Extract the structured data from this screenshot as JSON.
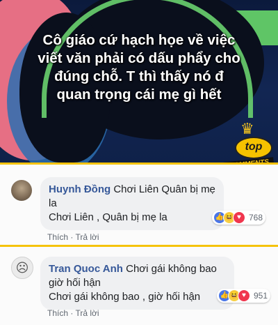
{
  "banner": {
    "caption_lines": [
      "Cô giáo cứ hạch họe về việc",
      "viết văn phải có dấu phẩy cho",
      "đúng chỗ. T thì thấy nó đ",
      "quan trọng cái mẹ gì hết"
    ],
    "badge_top": "top",
    "badge_comments": "COMMENTS",
    "badge_icon": "crown-icon"
  },
  "comments": [
    {
      "author": "Huynh Đồng",
      "text_part1": " Chơi Liên Quân bị mẹ la",
      "text_line2": "Chơi Liên , Quân bị mẹ la",
      "reaction_count": "768",
      "actions": {
        "like": "Thích",
        "separator": " · ",
        "reply": "Trả lời"
      },
      "avatar_icon": "user-avatar"
    },
    {
      "author": "Tran Quoc Anh",
      "text_part1": " Chơi gái không bao giờ hối hận",
      "text_line2": "Chơi gái không bao , giờ hối hận",
      "reaction_count": "951",
      "actions": {
        "like": "Thích",
        "separator": " · ",
        "reply": "Trả lời"
      },
      "avatar_icon": "sad-face-avatar"
    }
  ],
  "colors": {
    "author": "#365899",
    "accent_border": "#f5c30c",
    "like": "#4a76e8",
    "haha": "#f7cf45",
    "heart": "#f0364e"
  }
}
